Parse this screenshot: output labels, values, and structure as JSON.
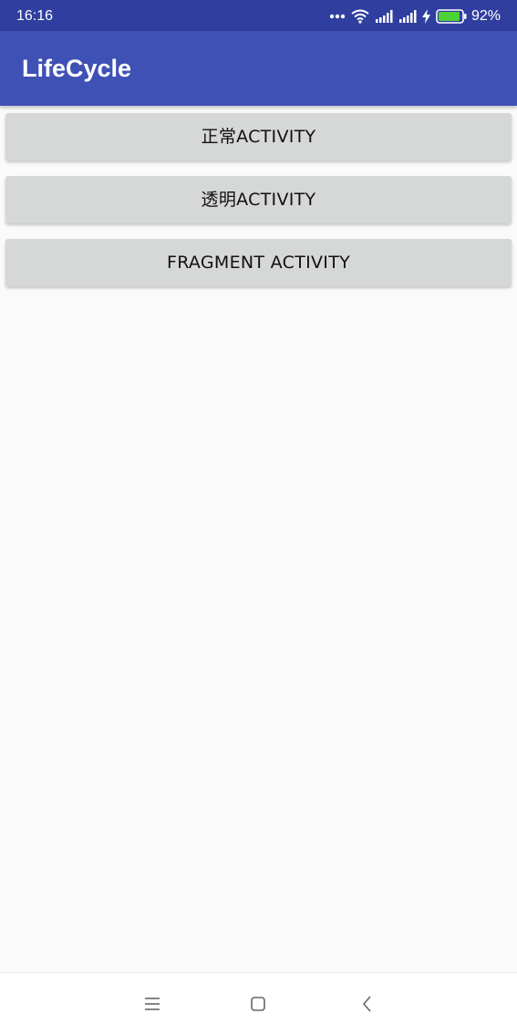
{
  "status_bar": {
    "time": "16:16",
    "battery_percent": "92%",
    "battery_level": 0.92,
    "icons": [
      "more-dots-icon",
      "wifi-icon",
      "signal-icon",
      "signal-icon",
      "charging-icon",
      "battery-icon"
    ],
    "battery_color": "#4cd137"
  },
  "app_bar": {
    "title": "LifeCycle",
    "color": "#3f51b5"
  },
  "buttons": [
    {
      "label": "正常ACTIVITY"
    },
    {
      "label": "透明ACTIVITY"
    },
    {
      "label": "FRAGMENT ACTIVITY"
    }
  ],
  "nav_bar": {
    "icons": [
      "menu-icon",
      "home-square-icon",
      "back-chevron-icon"
    ]
  },
  "colors": {
    "status_bar": "#303f9f",
    "primary": "#3f51b5",
    "button_bg": "#d6d7d7",
    "background": "#fafafa"
  }
}
